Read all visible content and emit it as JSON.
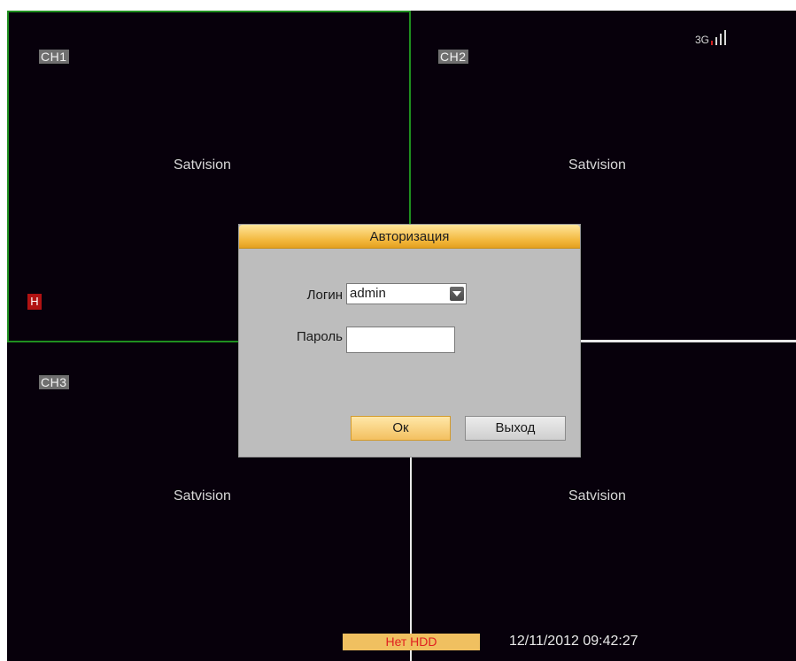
{
  "channels": {
    "ch1": "CH1",
    "ch2": "CH2",
    "ch3": "CH3"
  },
  "watermark": "Satvision",
  "badges": {
    "hdd_alarm": "H",
    "network": "3G"
  },
  "dialog": {
    "title": "Авторизация",
    "login_label": "Логин",
    "login_value": "admin",
    "password_label": "Пароль",
    "password_value": "",
    "ok_label": "Ок",
    "exit_label": "Выход"
  },
  "status": {
    "hdd_text": "Нет HDD",
    "datetime": "12/11/2012 09:42:27"
  },
  "colors": {
    "active_border": "#1f8f1f",
    "dialog_title": "#f2b63a",
    "alert_red": "#b01212"
  },
  "icons": {
    "signal": "signal-strength-icon",
    "dropdown": "chevron-down-icon"
  }
}
